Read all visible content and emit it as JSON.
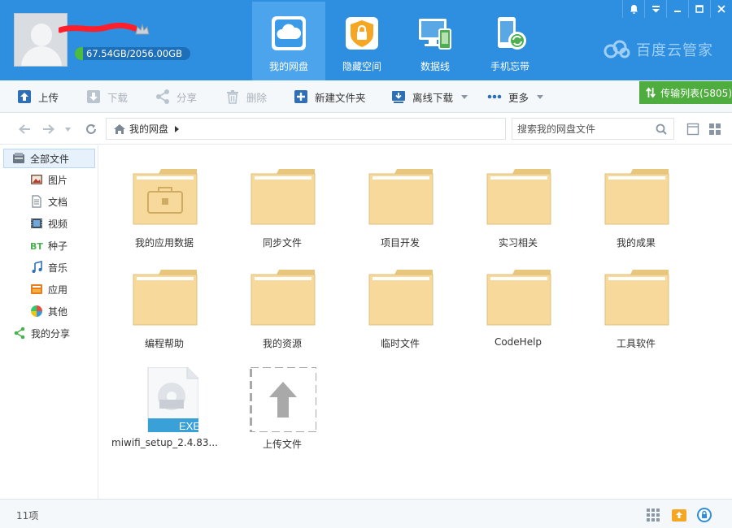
{
  "header": {
    "quota_text": "67.54GB/2056.00GB",
    "quota_fraction": 0.033,
    "tabs": [
      {
        "label": "我的网盘",
        "icon": "cloud-drive-icon",
        "active": true
      },
      {
        "label": "隐藏空间",
        "icon": "lock-shield-icon",
        "active": false
      },
      {
        "label": "数据线",
        "icon": "devices-icon",
        "active": false
      },
      {
        "label": "手机忘带",
        "icon": "phone-sync-icon",
        "active": false
      }
    ],
    "brand": "百度云管家",
    "accent": "#2e8fe0"
  },
  "toolbar": {
    "upload": "上传",
    "download": "下载",
    "share": "分享",
    "delete": "删除",
    "new_folder": "新建文件夹",
    "offline_download": "离线下载",
    "more": "更多",
    "transfer_list": "传输列表(5805)"
  },
  "addressbar": {
    "breadcrumb": "我的网盘",
    "search_placeholder": "搜索我的网盘文件"
  },
  "sidebar": {
    "items": [
      {
        "label": "全部文件",
        "icon": "all-files-icon"
      },
      {
        "label": "图片",
        "icon": "image-icon"
      },
      {
        "label": "文档",
        "icon": "document-icon"
      },
      {
        "label": "视频",
        "icon": "video-icon"
      },
      {
        "label": "种子",
        "icon": "bt-icon"
      },
      {
        "label": "音乐",
        "icon": "music-icon"
      },
      {
        "label": "应用",
        "icon": "app-icon"
      },
      {
        "label": "其他",
        "icon": "other-icon"
      },
      {
        "label": "我的分享",
        "icon": "share-icon"
      }
    ]
  },
  "files": {
    "items": [
      {
        "name": "我的应用数据",
        "type": "app-folder"
      },
      {
        "name": "同步文件",
        "type": "folder"
      },
      {
        "name": "项目开发",
        "type": "folder"
      },
      {
        "name": "实习相关",
        "type": "folder"
      },
      {
        "name": "我的成果",
        "type": "folder"
      },
      {
        "name": "编程帮助",
        "type": "folder"
      },
      {
        "name": "我的资源",
        "type": "folder"
      },
      {
        "name": "临时文件",
        "type": "folder"
      },
      {
        "name": "CodeHelp",
        "type": "folder"
      },
      {
        "name": "工具软件",
        "type": "folder"
      },
      {
        "name": "miwifi_setup_2.4.83...",
        "type": "exe",
        "badge": "EXE"
      },
      {
        "name": "上传文件",
        "type": "upload"
      }
    ]
  },
  "status": {
    "count": "11项"
  }
}
